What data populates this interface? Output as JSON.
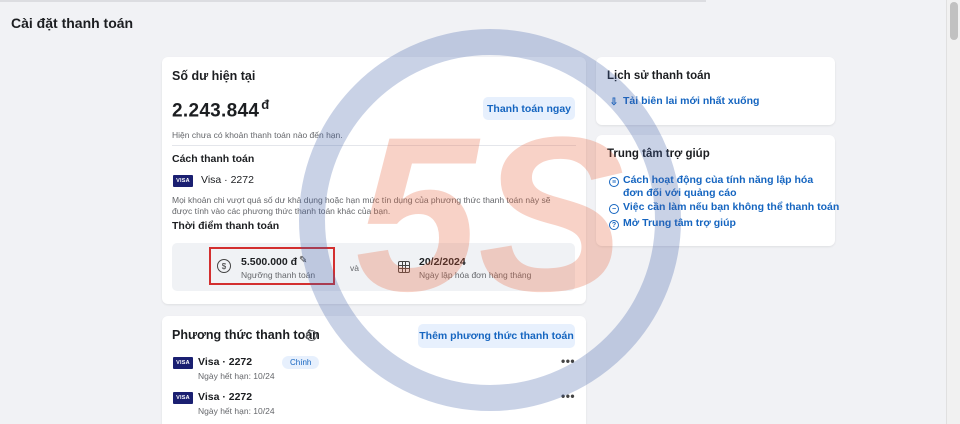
{
  "page": {
    "title": "Cài đặt thanh toán"
  },
  "balance": {
    "title": "Số dư hiện tại",
    "amount": "2.243.844",
    "currency": "đ",
    "pay_now_label": "Thanh toán ngay",
    "status": "Hiện chưa có khoản thanh toán nào đến hạn.",
    "method_title": "Cách thanh toán",
    "card_brand": "VISA",
    "card_label": "Visa · 2272",
    "note": "Mọi khoản chi vượt quá số dư khả dụng hoặc hạn mức tín dụng của phương thức thanh toán này sẽ được tính vào các phương thức thanh toán khác của bạn.",
    "timing_title": "Thời điểm thanh toán",
    "threshold_value": "5.500.000 đ",
    "threshold_label": "Ngưỡng thanh toán",
    "and_text": "và",
    "billing_date": "20/2/2024",
    "billing_label": "Ngày lập hóa đơn hàng tháng"
  },
  "payment_methods": {
    "title": "Phương thức thanh toán",
    "add_label": "Thêm phương thức thanh toán",
    "items": [
      {
        "brand": "VISA",
        "label": "Visa · 2272",
        "badge": "Chính",
        "expiry": "Ngày hết hạn: 10/24"
      },
      {
        "brand": "VISA",
        "label": "Visa · 2272",
        "badge": "",
        "expiry": "Ngày hết hạn: 10/24"
      }
    ]
  },
  "history": {
    "title": "Lịch sử thanh toán",
    "download_label": "Tải biên lai mới nhất xuống"
  },
  "help": {
    "title": "Trung tâm trợ giúp",
    "links": [
      "Cách hoạt động của tính năng lập hóa đơn đối với quảng cáo",
      "Việc cần làm nếu bạn không thể thanh toán",
      "Mở Trung tâm trợ giúp"
    ]
  },
  "watermark": {
    "text": "5S",
    "colors": [
      "#3f5fa8",
      "#e8623a"
    ]
  },
  "colors": {
    "accent": "#1565c0",
    "highlight_border": "#d32f2f",
    "visa": "#1a1f71"
  }
}
